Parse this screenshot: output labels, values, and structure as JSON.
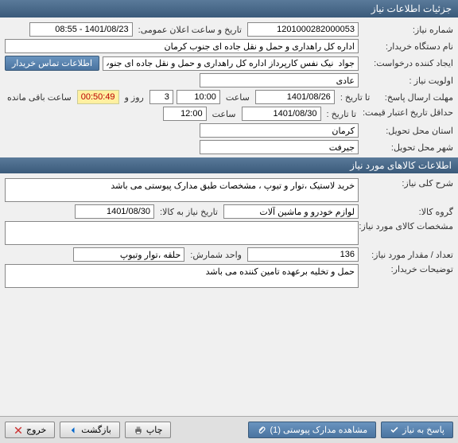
{
  "window_title": "جزئیات اطلاعات نیاز",
  "fields": {
    "need_number_label": "شماره نیاز:",
    "need_number": "1201000282000053",
    "announce_label": "تاریخ و ساعت اعلان عمومی:",
    "announce_value": "1401/08/23 - 08:55",
    "buyer_org_label": "نام دستگاه خریدار:",
    "buyer_org": "اداره کل راهداری و حمل و نقل جاده ای جنوب کرمان",
    "requester_label": "ایجاد کننده درخواست:",
    "requester": "جواد  نیک نفس کارپرداز اداره کل راهداری و حمل و نقل جاده ای جنوب کرمان",
    "contact_btn": "اطلاعات تماس خریدار",
    "priority_label": "اولویت نیاز :",
    "priority": "عادی",
    "deadline_send_label": "مهلت ارسال پاسخ:",
    "deadline_to_label": "تا تاریخ :",
    "deadline_date": "1401/08/26",
    "time_label": "ساعت",
    "deadline_time": "10:00",
    "days_val": "3",
    "days_and": "روز و",
    "countdown": "00:50:49",
    "remaining_label": "ساعت باقی مانده",
    "validity_label": "حداقل تاریخ اعتبار قیمت:",
    "validity_to_label": "تا تاریخ :",
    "validity_date": "1401/08/30",
    "validity_time": "12:00",
    "province_label": "استان محل تحویل:",
    "province": "کرمان",
    "city_label": "شهر محل تحویل:",
    "city": "جیرفت"
  },
  "section2_title": "اطلاعات کالاهای مورد نیاز",
  "goods": {
    "desc_label": "شرح کلی نیاز:",
    "desc": "خرید لاستیک ،توار و تیوپ ، مشخصات طبق مدارک پیوستی می باشد",
    "group_label": "گروه کالا:",
    "group": "لوازم خودرو و ماشین آلات",
    "need_by_label": "تاریخ نیاز به کالا:",
    "need_by": "1401/08/30",
    "spec_label": "مشخصات کالای مورد نیاز:",
    "spec": "",
    "qty_label": "تعداد / مقدار مورد نیاز:",
    "qty": "136",
    "unit_label": "واحد شمارش:",
    "unit": "حلقه ،توار وتیوپ",
    "buyer_notes_label": "توضیحات خریدار:",
    "buyer_notes": "حمل و تخلیه برعهده تامین کننده می باشد"
  },
  "footer": {
    "reply": "پاسخ به نیاز",
    "attachments": "مشاهده مدارک پیوستی (1)",
    "print": "چاپ",
    "back": "بازگشت",
    "exit": "خروج"
  }
}
